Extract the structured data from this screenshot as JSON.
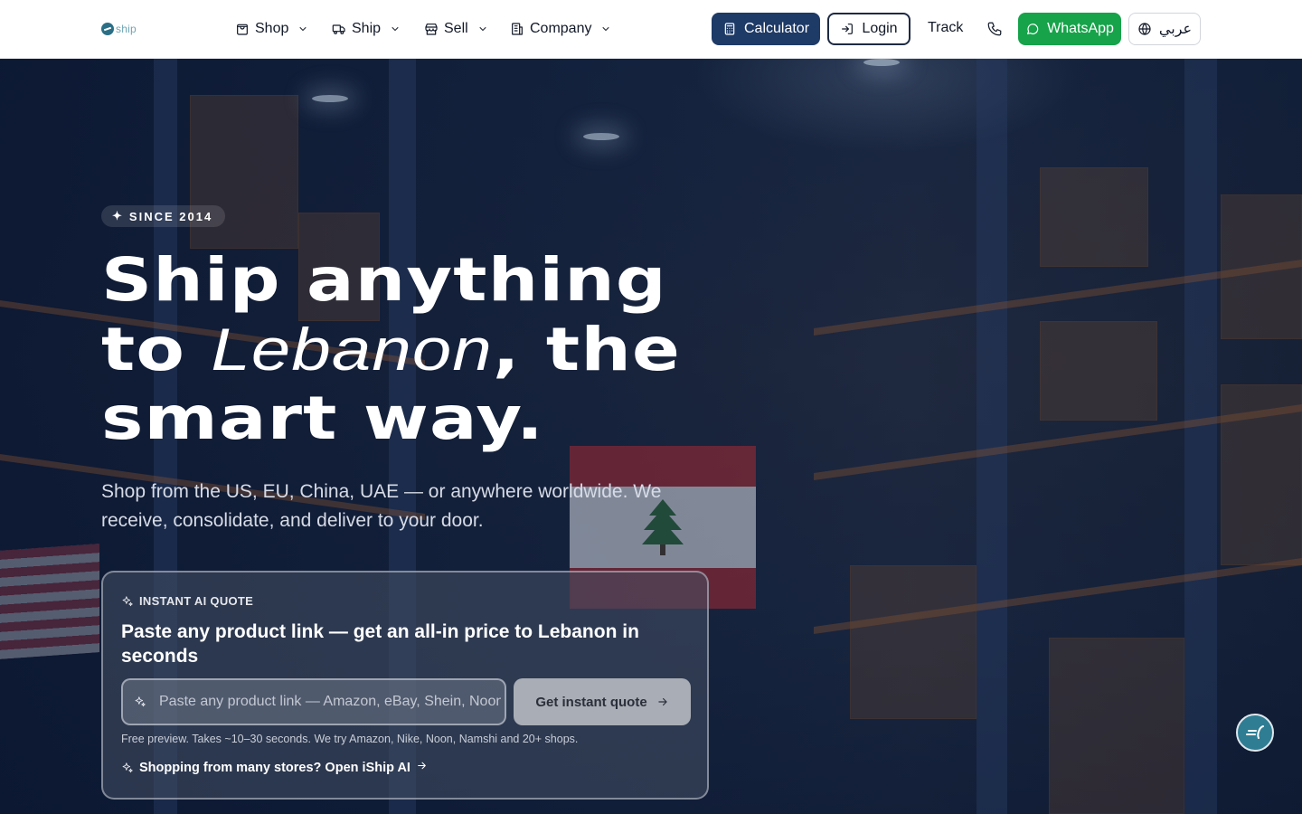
{
  "brand": {
    "logo_text": "ship"
  },
  "nav": {
    "menus": [
      {
        "label": "Shop",
        "icon": "shopping-bag-icon"
      },
      {
        "label": "Ship",
        "icon": "truck-icon"
      },
      {
        "label": "Sell",
        "icon": "store-icon"
      },
      {
        "label": "Company",
        "icon": "building-icon"
      }
    ],
    "calculator_label": "Calculator",
    "login_label": "Login",
    "track_label": "Track",
    "whatsapp_label": "WhatsApp",
    "language_label": "عربي"
  },
  "hero": {
    "badge": "SINCE 2014",
    "headline_line1": "Ship anything",
    "headline_to": "to",
    "headline_place": "Lebanon",
    "headline_rest": ", the",
    "headline_line3": "smart way.",
    "subtitle": "Shop from the US, EU, China, UAE — or anywhere worldwide. We receive, consolidate, and deliver to your door."
  },
  "quote_card": {
    "label": "INSTANT AI QUOTE",
    "title": "Paste any product link — get an all-in price to Lebanon in seconds",
    "input_placeholder": "Paste any product link — Amazon, eBay, Shein, Noon…",
    "input_value": "",
    "button_label": "Get instant quote",
    "note": "Free preview. Takes ~10–30 seconds. We try Amazon, Nike, Noon, Namshi and 20+ shops.",
    "link_label": "Shopping from many stores? Open iShip AI"
  },
  "colors": {
    "navy": "#1e3a66",
    "whatsapp_green": "#16a34a",
    "logo_teal": "#2b6f86",
    "hero_bg": "#0d1a33"
  }
}
